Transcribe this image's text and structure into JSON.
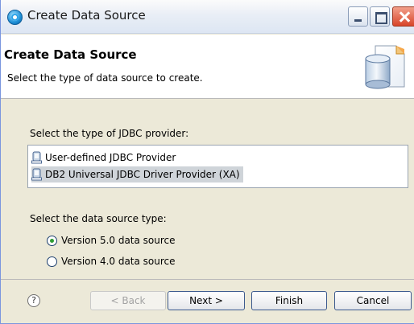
{
  "window": {
    "title": "Create Data Source"
  },
  "header": {
    "title": "Create Data Source",
    "description": "Select the type of data source to create."
  },
  "provider_section": {
    "label": "Select the type of JDBC provider:",
    "items": [
      {
        "label": "User-defined JDBC Provider",
        "selected": false
      },
      {
        "label": "DB2 Universal JDBC Driver Provider (XA)",
        "selected": true
      }
    ]
  },
  "type_section": {
    "label": "Select the data source type:",
    "options": [
      {
        "label": "Version 5.0 data source",
        "checked": true
      },
      {
        "label": "Version 4.0 data source",
        "checked": false
      }
    ]
  },
  "footer": {
    "help_symbol": "?",
    "back_label": "< Back",
    "next_label": "Next >",
    "finish_label": "Finish",
    "cancel_label": "Cancel"
  },
  "icons": {
    "app": "app-icon",
    "database": "database-icon",
    "jdbc_provider": "jdbc-provider-icon",
    "help": "help-icon"
  },
  "colors": {
    "selection": "#cfd4d9",
    "button_border": "#3c5a8e",
    "radio_dot": "#2e9c34"
  }
}
